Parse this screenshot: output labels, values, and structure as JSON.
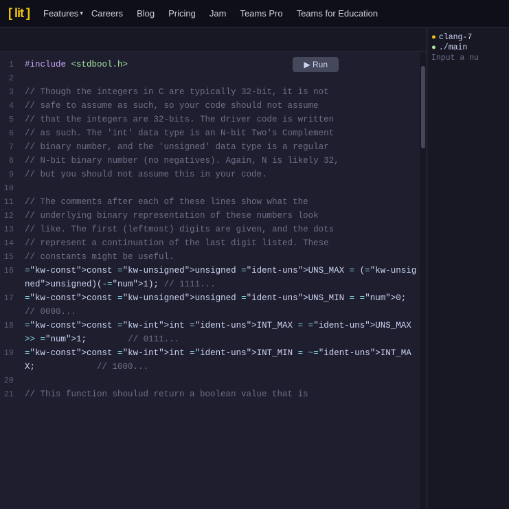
{
  "nav": {
    "logo_text": "lit",
    "logo_brackets": [
      "[",
      "]"
    ],
    "items": [
      {
        "label": "Features",
        "has_dropdown": true
      },
      {
        "label": "Careers"
      },
      {
        "label": "Blog"
      },
      {
        "label": "Pricing"
      },
      {
        "label": "Jam"
      },
      {
        "label": "Teams Pro"
      },
      {
        "label": "Teams for Education"
      }
    ]
  },
  "editor": {
    "tabs": [],
    "run_button": "▶ Run",
    "lines": [
      {
        "num": 1,
        "type": "include",
        "raw": "#include <stdbool.h>"
      },
      {
        "num": 2,
        "type": "blank",
        "raw": ""
      },
      {
        "num": 3,
        "type": "comment",
        "raw": "// Though the integers in C are typically 32-bit, it is not"
      },
      {
        "num": 4,
        "type": "comment",
        "raw": "// safe to assume as such, so your code should not assume"
      },
      {
        "num": 5,
        "type": "comment",
        "raw": "// that the integers are 32-bits. The driver code is written"
      },
      {
        "num": 6,
        "type": "comment",
        "raw": "// as such. The 'int' data type is an N-bit Two's Complement"
      },
      {
        "num": 7,
        "type": "comment",
        "raw": "// binary number, and the 'unsigned' data type is a regular"
      },
      {
        "num": 8,
        "type": "comment",
        "raw": "// N-bit binary number (no negatives). Again, N is likely 32,"
      },
      {
        "num": 9,
        "type": "comment",
        "raw": "// but you should not assume this in your code."
      },
      {
        "num": 10,
        "type": "blank",
        "raw": ""
      },
      {
        "num": 11,
        "type": "comment",
        "raw": "// The comments after each of these lines show what the"
      },
      {
        "num": 12,
        "type": "comment",
        "raw": "// underlying binary representation of these numbers look"
      },
      {
        "num": 13,
        "type": "comment",
        "raw": "// like. The first (leftmost) digits are given, and the dots"
      },
      {
        "num": 14,
        "type": "comment",
        "raw": "// represent a continuation of the last digit listed. These"
      },
      {
        "num": 15,
        "type": "comment",
        "raw": "// constants might be useful."
      },
      {
        "num": 16,
        "type": "code",
        "raw": "const unsigned UNS_MAX = (unsigned)(-1); // 1111..."
      },
      {
        "num": 17,
        "type": "code",
        "raw": "const unsigned UNS_MIN = 0;              // 0000..."
      },
      {
        "num": 18,
        "type": "code",
        "raw": "const int INT_MAX = UNS_MAX >> 1;        // 0111..."
      },
      {
        "num": 19,
        "type": "code",
        "raw": "const int INT_MIN = ~INT_MAX;            // 1000..."
      },
      {
        "num": 20,
        "type": "blank",
        "raw": ""
      },
      {
        "num": 21,
        "type": "comment",
        "raw": "// This function shoulud return a boolean value that is"
      }
    ]
  },
  "right_panel": {
    "items": [
      {
        "icon": "●",
        "icon_color": "yellow",
        "text": "clang-7"
      },
      {
        "icon": "●",
        "icon_color": "green",
        "text": "./main"
      },
      {
        "label": "Input a nu"
      }
    ]
  }
}
